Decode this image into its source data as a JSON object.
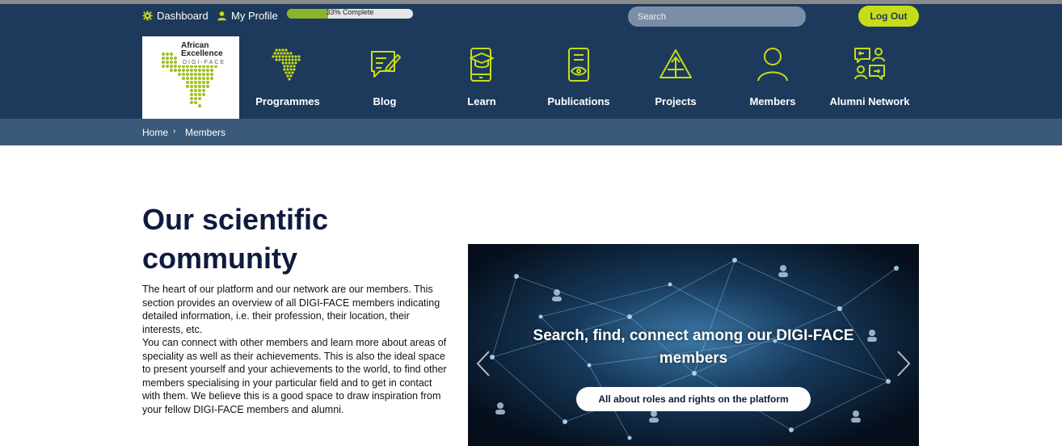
{
  "topbar": {
    "dashboard_label": "Dashboard",
    "profile_label": "My Profile",
    "progress_text": "33% Complete",
    "progress_value": 0.33,
    "search_placeholder": "Search",
    "logout_label": "Log Out"
  },
  "logo": {
    "line1": "African",
    "line2": "Excellence",
    "line3": "DIGI-FACE"
  },
  "nav": {
    "items": [
      {
        "label": "Programmes",
        "icon": "africa-map-icon"
      },
      {
        "label": "Blog",
        "icon": "chat-pencil-icon"
      },
      {
        "label": "Learn",
        "icon": "mobile-graduation-icon"
      },
      {
        "label": "Publications",
        "icon": "document-eye-icon"
      },
      {
        "label": "Projects",
        "icon": "pyramid-icon"
      },
      {
        "label": "Members",
        "icon": "person-icon"
      },
      {
        "label": "Alumni Network",
        "icon": "people-exchange-icon"
      }
    ]
  },
  "breadcrumb": {
    "home": "Home",
    "separator": "›",
    "current": "Members"
  },
  "main": {
    "title": "Our scientific community",
    "paragraph1": "The heart of our platform and our network are our members. This section provides an overview of all DIGI-FACE members indicating detailed information, i.e. their profession, their location, their interests, etc.",
    "paragraph2": "You can connect with other members and learn more about areas of speciality as well as their achievements. This is also the ideal space to present yourself and your achievements to the world, to find other members specialising in your particular field and to get in contact with them. We believe this is a good space to draw inspiration from your fellow DIGI-FACE members and alumni."
  },
  "hero": {
    "title": "Search, find, connect among our DIGI-FACE members",
    "button_label": "All about roles and rights on the platform"
  },
  "colors": {
    "navy": "#1d3a5c",
    "breadcrumb": "#3b5a79",
    "accent": "#c7dc18",
    "progress_fill": "#8cb42a",
    "title": "#0e1b3d"
  }
}
